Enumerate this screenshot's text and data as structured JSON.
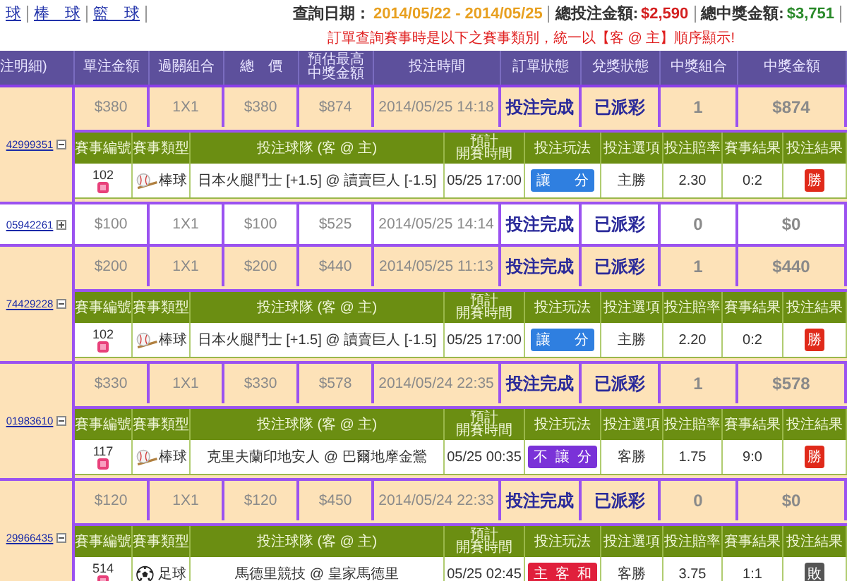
{
  "nav": {
    "links": [
      {
        "label": "球"
      },
      {
        "label": "棒　球"
      },
      {
        "label": "籃　球"
      }
    ]
  },
  "summary": {
    "date_label": "查詢日期：",
    "date_range": "2014/05/22 - 2014/05/25",
    "total_bet_label": "總投注金額:",
    "total_bet": "$2,590",
    "total_win_label": "總中獎金額:",
    "total_win": "$3,751"
  },
  "notice": "訂單查詢賽事時是以下之賽事類別，統一以【客 @ 主】順序顯示!",
  "table": {
    "columns": [
      "注明細)",
      "單注金額",
      "過關組合",
      "總　價",
      [
        "預估最高",
        "中獎金額"
      ],
      "投注時間",
      "訂單狀態",
      "兌獎狀態",
      "中獎組合",
      "中獎金額"
    ],
    "orders": [
      {
        "id": "42999351",
        "expanded": true,
        "won": true,
        "cells": [
          "$380",
          "1X1",
          "$380",
          "$874",
          "2014/05/25 14:18"
        ],
        "order_status": "投注完成",
        "payout_status": "已派彩",
        "win_count": "1",
        "win_amount": "$874",
        "detail": {
          "columns": [
            "賽事編號",
            "賽事類型",
            "投注球隊 (客 @ 主)",
            [
              "預計",
              "開賽時間"
            ],
            "投注玩法",
            "投注選項",
            "投注賠率",
            "賽事結果",
            "投注結果"
          ],
          "event_no": "102",
          "sport": {
            "kind": "baseball",
            "label": "棒球"
          },
          "teams": "日本火腿鬥士 [+1.5] @ 讀賣巨人 [-1.5]",
          "start_time": "05/25 17:00",
          "bet_type": {
            "kind": "handicap",
            "label": "讓      分"
          },
          "option": "主勝",
          "odds": "2.30",
          "score": "0:2",
          "result": {
            "kind": "win",
            "label": "勝"
          }
        }
      },
      {
        "id": "05942261",
        "expanded": false,
        "won": false,
        "cells": [
          "$100",
          "1X1",
          "$100",
          "$525",
          "2014/05/25 14:14"
        ],
        "order_status": "投注完成",
        "payout_status": "已派彩",
        "win_count": "0",
        "win_amount": "$0"
      },
      {
        "id": "74429228",
        "expanded": true,
        "won": true,
        "cells": [
          "$200",
          "1X1",
          "$200",
          "$440",
          "2014/05/25 11:13"
        ],
        "order_status": "投注完成",
        "payout_status": "已派彩",
        "win_count": "1",
        "win_amount": "$440",
        "detail": {
          "columns": [
            "賽事編號",
            "賽事類型",
            "投注球隊 (客 @ 主)",
            [
              "預計",
              "開賽時間"
            ],
            "投注玩法",
            "投注選項",
            "投注賠率",
            "賽事結果",
            "投注結果"
          ],
          "event_no": "102",
          "sport": {
            "kind": "baseball",
            "label": "棒球"
          },
          "teams": "日本火腿鬥士 [+1.5] @ 讀賣巨人 [-1.5]",
          "start_time": "05/25 17:00",
          "bet_type": {
            "kind": "handicap",
            "label": "讓      分"
          },
          "option": "主勝",
          "odds": "2.20",
          "score": "0:2",
          "result": {
            "kind": "win",
            "label": "勝"
          }
        }
      },
      {
        "id": "01983610",
        "expanded": true,
        "won": true,
        "cells": [
          "$330",
          "1X1",
          "$330",
          "$578",
          "2014/05/24 22:35"
        ],
        "order_status": "投注完成",
        "payout_status": "已派彩",
        "win_count": "1",
        "win_amount": "$578",
        "detail": {
          "columns": [
            "賽事編號",
            "賽事類型",
            "投注球隊 (客 @ 主)",
            [
              "預計",
              "開賽時間"
            ],
            "投注玩法",
            "投注選項",
            "投注賠率",
            "賽事結果",
            "投注結果"
          ],
          "event_no": "117",
          "sport": {
            "kind": "baseball",
            "label": "棒球"
          },
          "teams": "克里夫蘭印地安人 @ 巴爾地摩金鶯",
          "start_time": "05/25 00:35",
          "bet_type": {
            "kind": "no_handicap",
            "label": "不  讓  分"
          },
          "option": "客勝",
          "odds": "1.75",
          "score": "9:0",
          "result": {
            "kind": "win",
            "label": "勝"
          }
        }
      },
      {
        "id": "29966435",
        "expanded": true,
        "won": false,
        "cells": [
          "$120",
          "1X1",
          "$120",
          "$450",
          "2014/05/24 22:33"
        ],
        "order_status": "投注完成",
        "payout_status": "已派彩",
        "win_count": "0",
        "win_amount": "$0",
        "detail": {
          "columns": [
            "賽事編號",
            "賽事類型",
            "投注球隊 (客 @ 主)",
            [
              "預計",
              "開賽時間"
            ],
            "投注玩法",
            "投注選項",
            "投注賠率",
            "賽事結果",
            "投注結果"
          ],
          "event_no": "514",
          "sport": {
            "kind": "soccer",
            "label": "足球"
          },
          "teams": "馬德里競技 @ 皇家馬德里",
          "start_time": "05/25 02:45",
          "bet_type": {
            "kind": "draw",
            "label": "主  客  和"
          },
          "option": "客勝",
          "odds": "3.75",
          "score": "1:1",
          "result": {
            "kind": "lose",
            "label": "敗"
          }
        }
      }
    ]
  }
}
